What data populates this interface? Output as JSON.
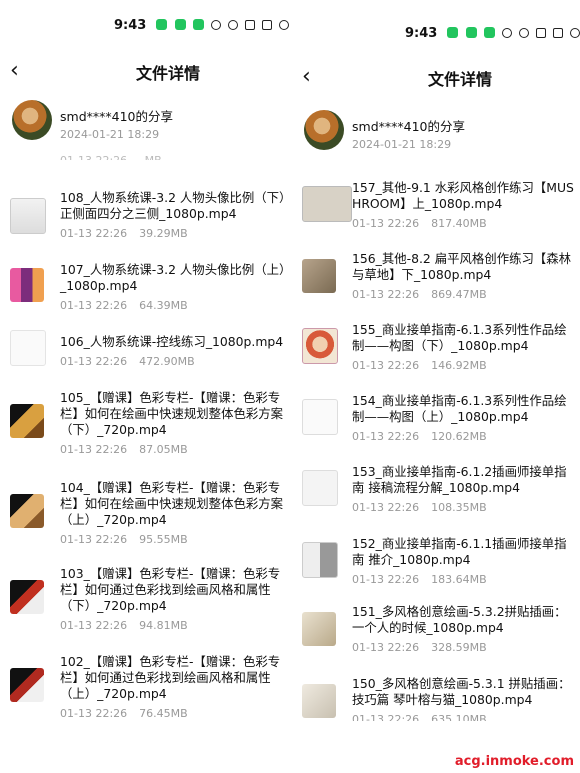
{
  "left": {
    "status": {
      "time": "9:43",
      "signal": "4G"
    },
    "title": "文件详情",
    "sharer": {
      "name": "smd****410的分享",
      "date": "2024-01-21  18:29"
    },
    "cut_row": "01-13 22:26 ... MB",
    "files": [
      {
        "name": "108_人物系统课-3.2 人物头像比例（下）正侧面四分之三侧_1080p.mp4",
        "date": "01-13  22:26",
        "size": "39.29MB"
      },
      {
        "name": "107_人物系统课-3.2 人物头像比例（上）_1080p.mp4",
        "date": "01-13  22:26",
        "size": "64.39MB"
      },
      {
        "name": "106_人物系统课-控线练习_1080p.mp4",
        "date": "01-13  22:26",
        "size": "472.90MB"
      },
      {
        "name": "105_【赠课】色彩专栏-【赠课：色彩专栏】如何在绘画中快速规划整体色彩方案（下）_720p.mp4",
        "date": "01-13  22:26",
        "size": "87.05MB"
      },
      {
        "name": "104_【赠课】色彩专栏-【赠课：色彩专栏】如何在绘画中快速规划整体色彩方案（上）_720p.mp4",
        "date": "01-13  22:26",
        "size": "95.55MB"
      },
      {
        "name": "103_【赠课】色彩专栏-【赠课：色彩专栏】如何通过色彩找到绘画风格和属性（下）_720p.mp4",
        "date": "01-13  22:26",
        "size": "94.81MB"
      },
      {
        "name": "102_【赠课】色彩专栏-【赠课：色彩专栏】如何通过色彩找到绘画风格和属性（上）_720p.mp4",
        "date": "01-13  22:26",
        "size": "76.45MB"
      }
    ]
  },
  "right": {
    "status": {
      "time": "9:43",
      "signal": "4G"
    },
    "title": "文件详情",
    "sharer": {
      "name": "smd****410的分享",
      "date": "2024-01-21  18:29"
    },
    "files": [
      {
        "name": "157_其他-9.1 水彩风格创作练习【MUSHROOM】上_1080p.mp4",
        "date": "01-13  22:26",
        "size": "817.40MB"
      },
      {
        "name": "156_其他-8.2 扁平风格创作练习【森林与草地】下_1080p.mp4",
        "date": "01-13  22:26",
        "size": "869.47MB"
      },
      {
        "name": "155_商业接单指南-6.1.3系列性作品绘制——构图（下）_1080p.mp4",
        "date": "01-13  22:26",
        "size": "146.92MB"
      },
      {
        "name": "154_商业接单指南-6.1.3系列性作品绘制——构图（上）_1080p.mp4",
        "date": "01-13  22:26",
        "size": "120.62MB"
      },
      {
        "name": "153_商业接单指南-6.1.2插画师接单指南 接稿流程分解_1080p.mp4",
        "date": "01-13  22:26",
        "size": "108.35MB"
      },
      {
        "name": "152_商业接单指南-6.1.1插画师接单指南 推介_1080p.mp4",
        "date": "01-13  22:26",
        "size": "183.64MB"
      },
      {
        "name": "151_多风格创意绘画-5.3.2拼贴插画：一个人的时候_1080p.mp4",
        "date": "01-13  22:26",
        "size": "328.59MB"
      },
      {
        "name": "150_多风格创意绘画-5.3.1 拼贴插画：技巧篇 琴叶榕与猫_1080p.mp4",
        "date": "01-13  22:26",
        "size": "635.10MB"
      }
    ]
  },
  "watermark": "acg.inmoke.com"
}
